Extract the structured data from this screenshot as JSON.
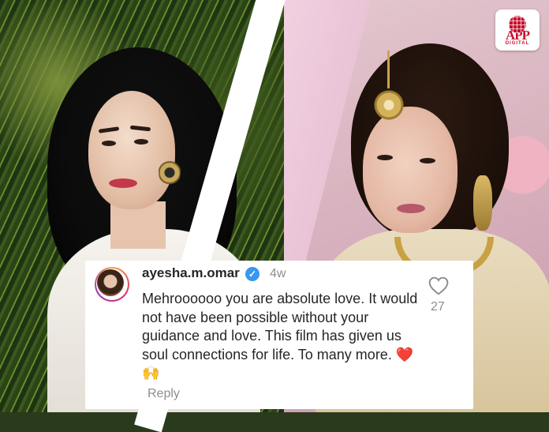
{
  "logo": {
    "brand": "APP",
    "sub": "DIGITAL"
  },
  "comment": {
    "username": "ayesha.m.omar",
    "verified_mark": "✓",
    "time": "4w",
    "text": "Mehroooooo you are absolute love. It would not have been possible without your guidance and love. This film has given us soul connections for life. To many more.",
    "emoji": "❤️🙌",
    "likes": "27",
    "reply_label": "Reply"
  },
  "icons": {
    "like": "heart-icon",
    "verified": "verified-badge-icon"
  },
  "colors": {
    "logo_red": "#c8102e",
    "verified_blue": "#3897f0",
    "muted": "#8e8e8e"
  }
}
